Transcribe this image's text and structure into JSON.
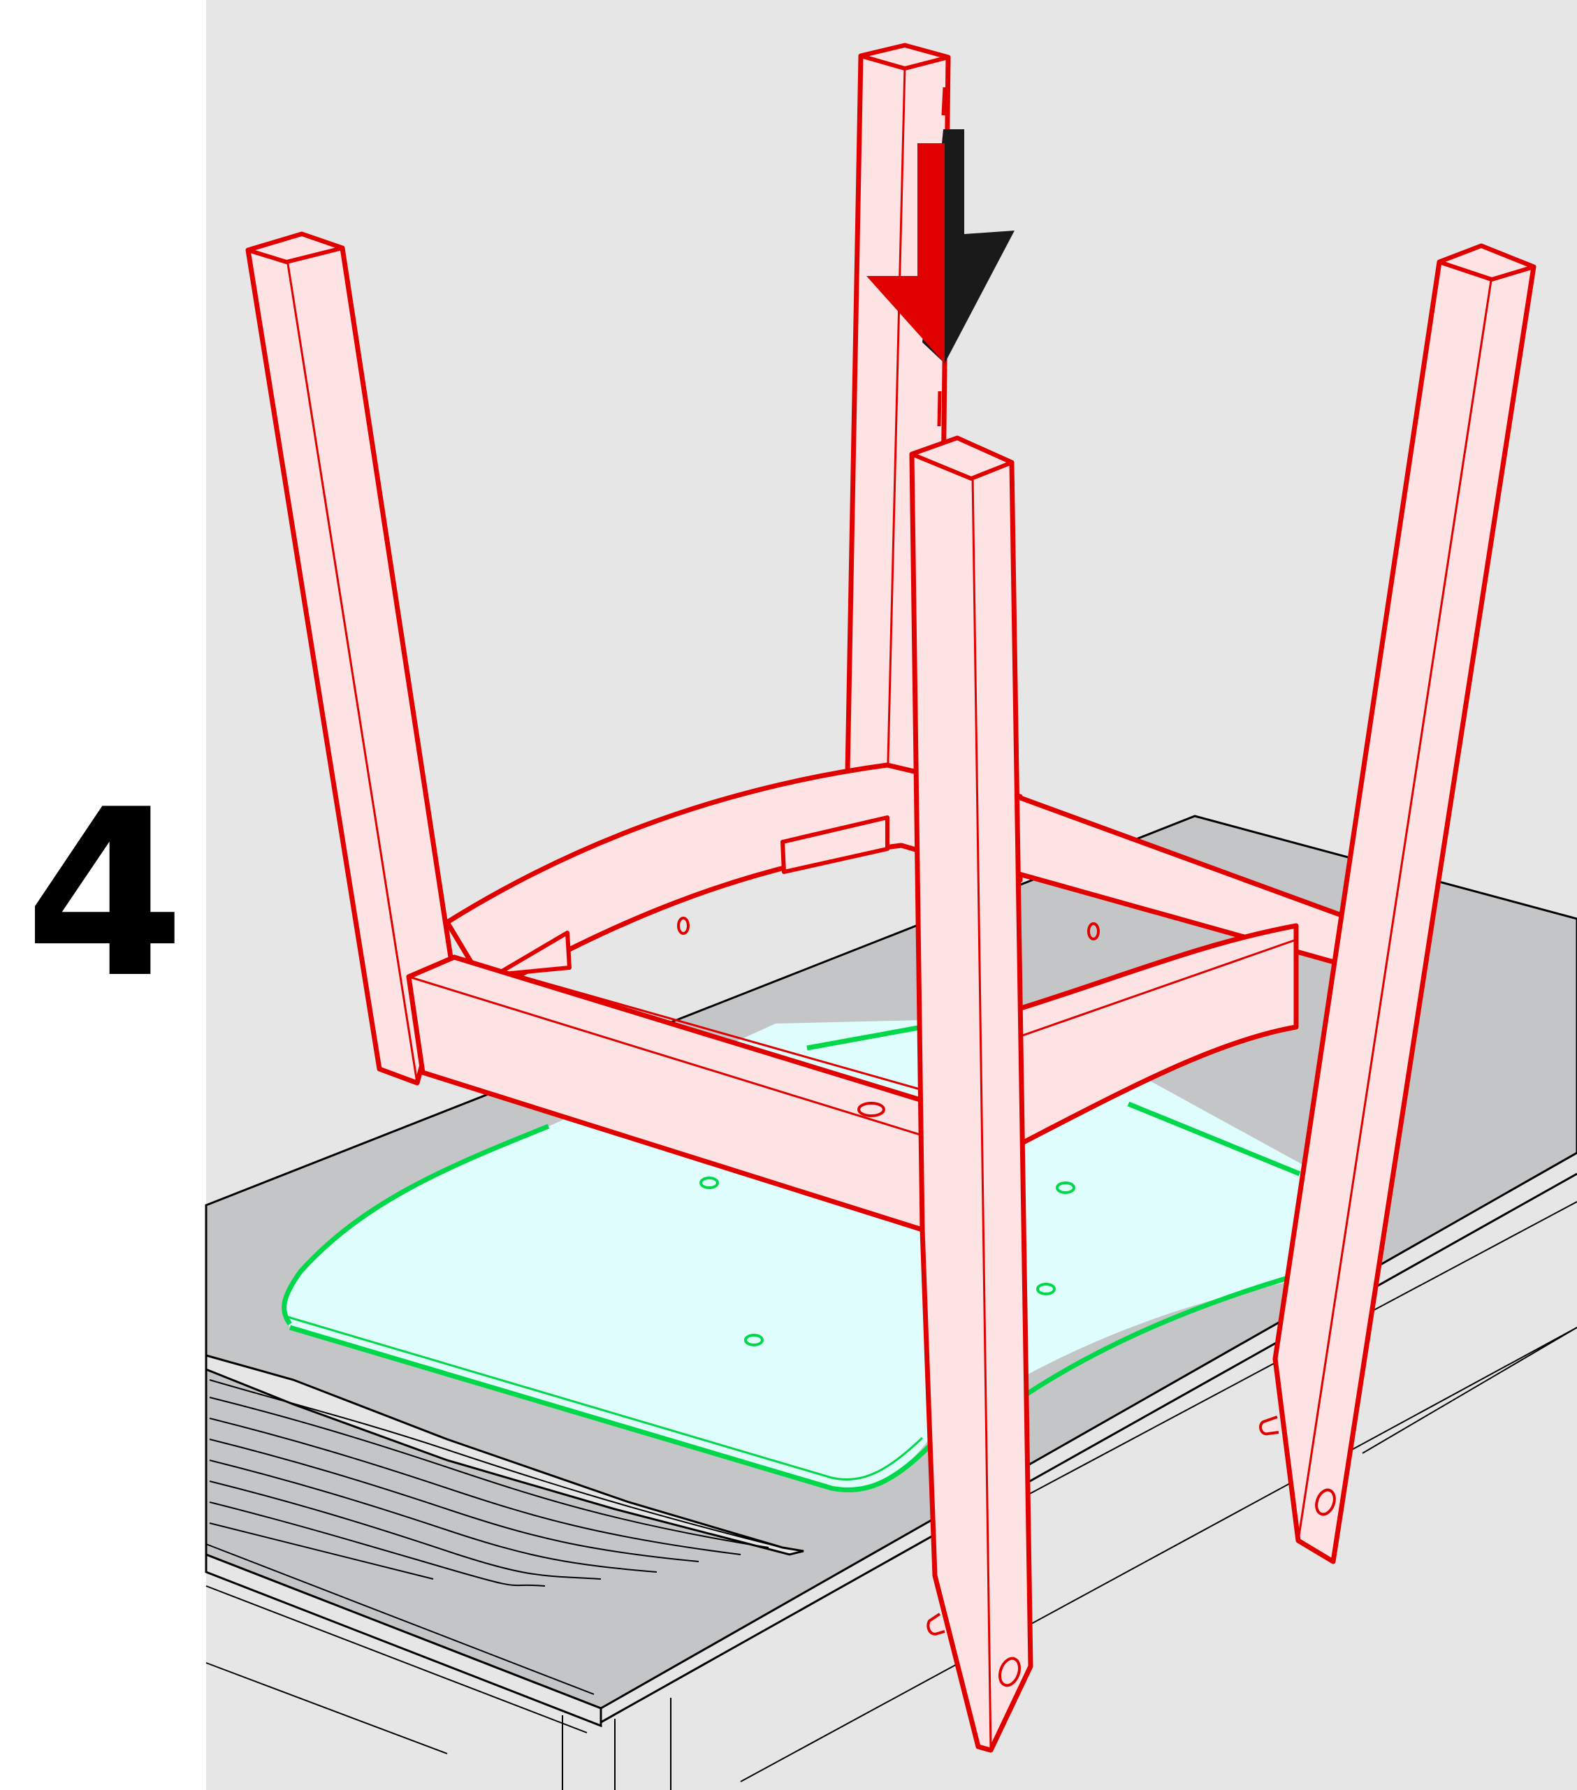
{
  "step": {
    "number": "4"
  },
  "colors": {
    "panel_background": "#e6e6e6",
    "table_top": "#c4c5c6",
    "frame_fill": "#fde3e3",
    "frame_stroke": "#e00000",
    "seat_fill": "#e0fdfd",
    "seat_stroke": "#00d84a",
    "arrow_front": "#e00000",
    "arrow_shadow": "#1a1a1a",
    "line_art": "#000000"
  },
  "icons": {
    "arrow": "down-arrow-icon"
  }
}
